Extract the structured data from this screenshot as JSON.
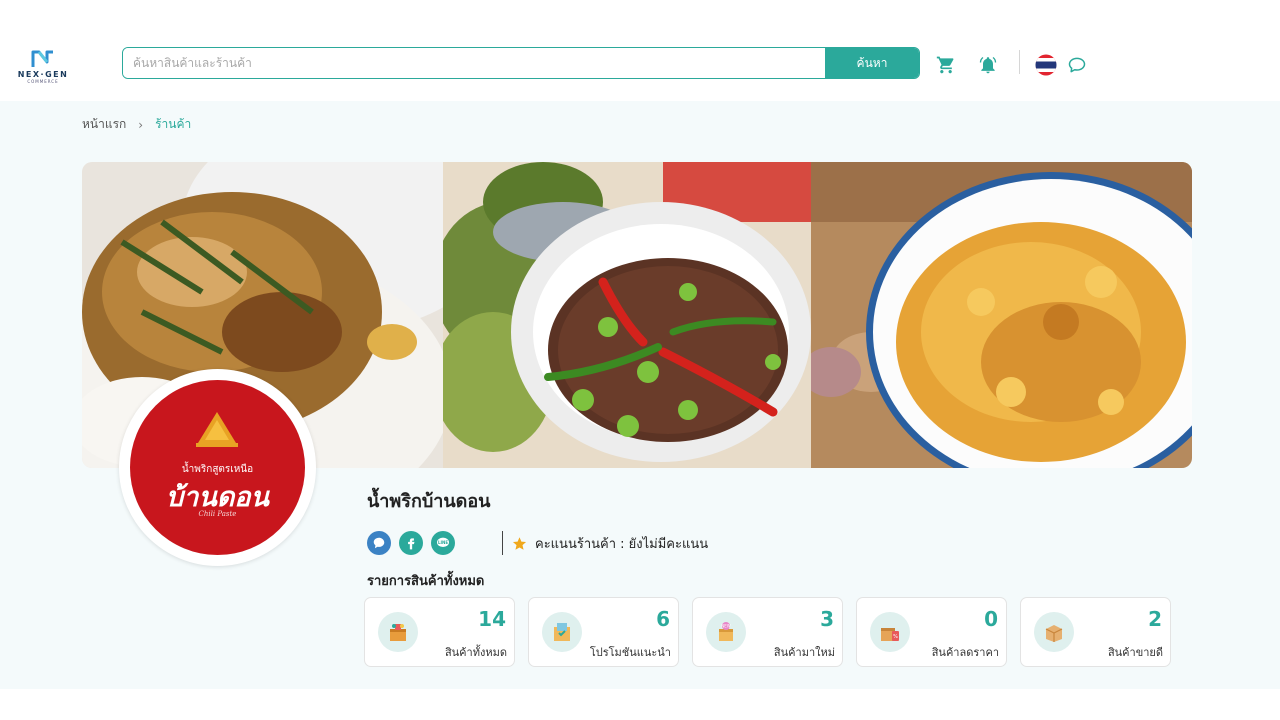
{
  "header": {
    "logo_text": "NEX·GEN",
    "logo_sub": "COMMERCE",
    "search_placeholder": "ค้นหาสินค้าและร้านค้า",
    "search_button": "ค้นหา",
    "cart_icon": "cart-icon",
    "bell_icon": "bell-icon",
    "language_flag": "thailand-flag-icon",
    "chat_icon": "chat-bubble-icon"
  },
  "breadcrumb": {
    "home": "หน้าแรก",
    "separator": "›",
    "current": "ร้านค้า"
  },
  "shop": {
    "logo_top": "น้ำพริกสูตรเหนือ",
    "logo_main": "บ้านดอน",
    "logo_sub": "Chili Paste",
    "name": "น้ำพริกบ้านดอน",
    "social": [
      {
        "name": "chat",
        "icon": "chat-icon",
        "color": "#3b82c4"
      },
      {
        "name": "facebook",
        "icon": "facebook-icon",
        "color": "#2ba99b"
      },
      {
        "name": "line",
        "icon": "line-icon",
        "color": "#2ba99b"
      }
    ],
    "rating_label": "คะแนนร้านค้า : ยังไม่มีคะแนน"
  },
  "products_section": {
    "title": "รายการสินค้าทั้งหมด",
    "stats": [
      {
        "value": "14",
        "label": "สินค้าทั้งหมด",
        "icon": "box-all-icon"
      },
      {
        "value": "6",
        "label": "โปรโมชันแนะนำ",
        "icon": "promotion-box-icon"
      },
      {
        "value": "3",
        "label": "สินค้ามาใหม่",
        "icon": "new-product-icon"
      },
      {
        "value": "0",
        "label": "สินค้าลดราคา",
        "icon": "discount-box-icon"
      },
      {
        "value": "2",
        "label": "สินค้าขายดี",
        "icon": "bestseller-box-icon"
      }
    ]
  },
  "colors": {
    "accent": "#2ba99b",
    "brand_red": "#c8161d",
    "page_bg": "#f4fafb"
  }
}
